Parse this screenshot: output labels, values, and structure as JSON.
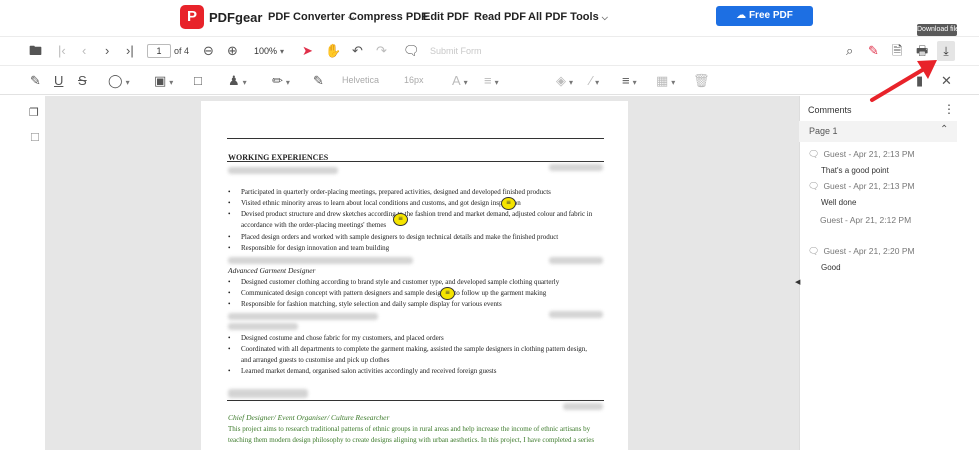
{
  "topnav": {
    "logo_letter": "P",
    "brand": "PDFgear",
    "items": [
      {
        "label": "PDF Converter",
        "has_dropdown": true
      },
      {
        "label": "Compress PDF",
        "has_dropdown": false
      },
      {
        "label": "Edit PDF",
        "has_dropdown": false
      },
      {
        "label": "Read PDF",
        "has_dropdown": false
      },
      {
        "label": "All PDF Tools",
        "has_dropdown": true
      }
    ],
    "cta": "Free PDF Software",
    "cta_color": "#1d6fe3",
    "logo_color": "#e8232a"
  },
  "tooltip": "Download file",
  "toolbar": {
    "page_current": "1",
    "page_total": "of 4",
    "zoom": "100%",
    "submit_form": "Submit Form",
    "font_name": "Helvetica",
    "font_size": "16px"
  },
  "document": {
    "section_work": "WORKING EXPERIENCES",
    "bullets_a": [
      "Participated in quarterly order-placing meetings, prepared activities, designed and developed finished products",
      "Visited ethnic minority areas to learn about local conditions and customs, and got design inspiration",
      "Devised product structure and drew sketches according to the fashion trend and market demand, adjusted colour and fabric in",
      "accordance with the order-placing meetings' themes",
      "Placed design orders and worked with sample designers to design technical details and make the finished product",
      "Responsible for design innovation and team building"
    ],
    "role_b": "Advanced Garment Designer",
    "bullets_b": [
      "Designed customer clothing according to brand style and customer type, and developed sample clothing quarterly",
      "Communicated design concept with pattern designers and sample designers to follow up the garment making",
      "Responsible for fashion matching, style selection and daily sample display for various events"
    ],
    "bullets_c": [
      "Designed costume and chose fabric for my customers, and placed orders",
      "Coordinated with all departments to complete the garment making, assisted the sample designers in clothing pattern design,",
      "and arranged guests to customise and pick up clothes",
      "Learned market demand, organised salon activities accordingly and received foreign guests"
    ],
    "role_d": "Chief Designer/ Event Organiser/ Culture Researcher",
    "para_d": [
      "This project aims to research traditional patterns of ethnic groups in rural areas and help increase the income of ethnic artisans by",
      "teaching them modern design philosophy to create designs aligning with urban aesthetics. In this project, I have completed a series"
    ]
  },
  "comments": {
    "title": "Comments",
    "page_label": "Page 1",
    "items": [
      {
        "author": "Guest - Apr 21, 2:13 PM",
        "body": "That's a good point"
      },
      {
        "author": "Guest - Apr 21, 2:13 PM",
        "body": "Well done"
      },
      {
        "author": "Guest - Apr 21, 2:12 PM",
        "body": ""
      },
      {
        "author": "Guest - Apr 21, 2:20 PM",
        "body": "Good"
      }
    ]
  },
  "colors": {
    "accent_blue": "#1d6fe3",
    "annotation_red": "#e8232a",
    "comment_yellow": "#f5e400",
    "project_green": "#3c7a2a"
  }
}
